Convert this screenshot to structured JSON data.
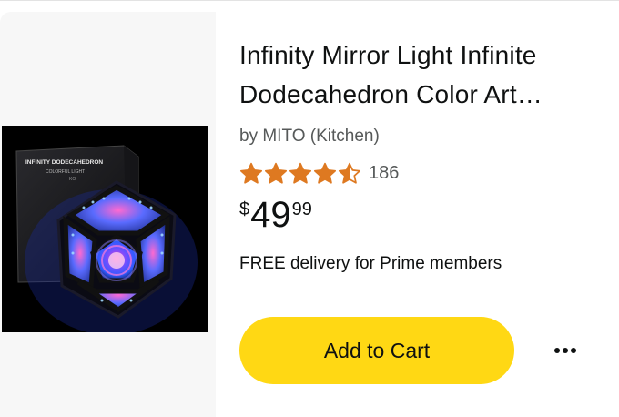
{
  "product": {
    "title_line1": "Infinity Mirror Light Infinite",
    "title_line2": "Dodecahedron Color Art…",
    "brand": "by MITO (Kitchen)",
    "rating": 4.5,
    "rating_max": 5,
    "rating_count": "186",
    "price_symbol": "$",
    "price_whole": "49",
    "price_fraction": "99",
    "delivery": "FREE delivery for Prime members",
    "image_box_text": {
      "line1": "INFINITY DODECAHEDRON",
      "line2": "COLORFUL LIGHT",
      "line3": "KO"
    }
  },
  "actions": {
    "add_to_cart_label": "Add to Cart",
    "more_icon": "more-horizontal-icon"
  },
  "colors": {
    "button_yellow": "#ffd814",
    "star_orange": "#de7921",
    "text_primary": "#0f1111",
    "text_secondary": "#565959",
    "image_pane_bg": "#f7f7f7"
  }
}
